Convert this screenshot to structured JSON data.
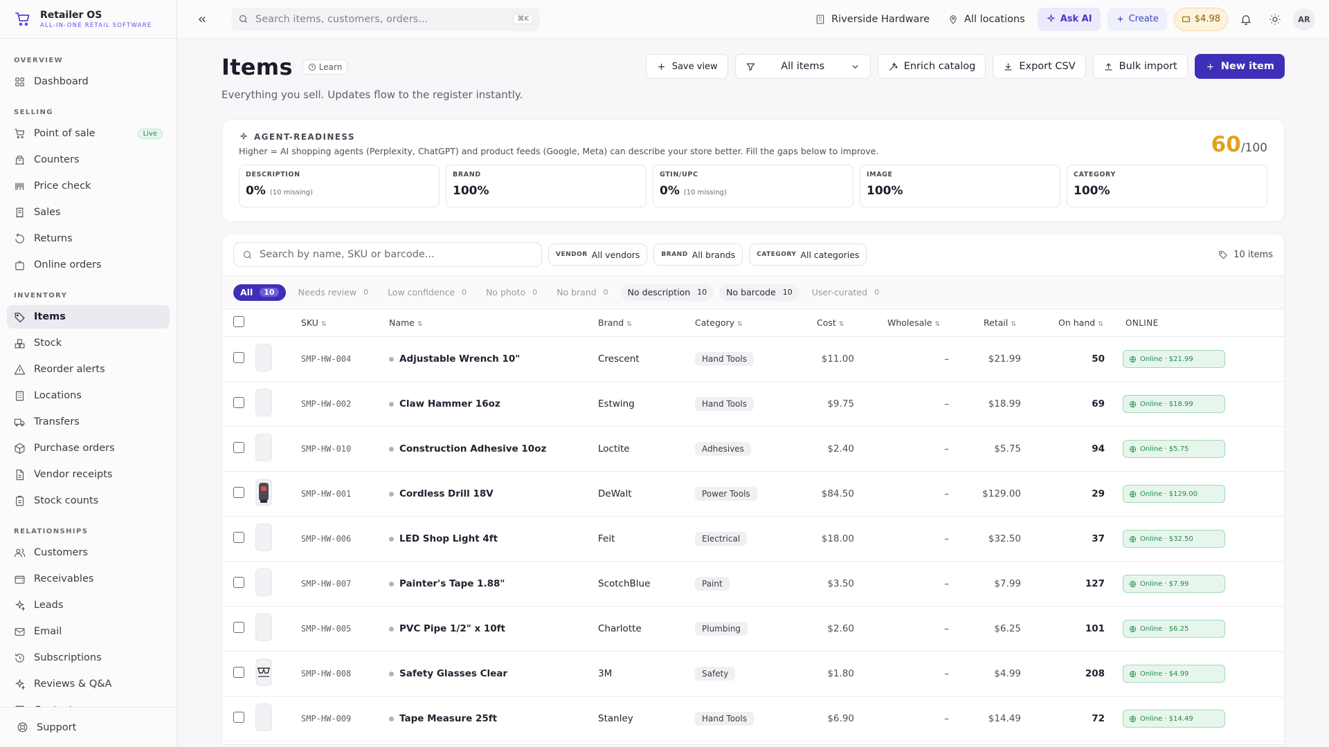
{
  "app": {
    "name": "Retailer OS",
    "tagline": "ALL-IN-ONE RETAIL SOFTWARE"
  },
  "sidebar": {
    "sections": [
      {
        "title": "OVERVIEW",
        "items": [
          {
            "label": "Dashboard",
            "icon": "grid-icon"
          }
        ]
      },
      {
        "title": "SELLING",
        "items": [
          {
            "label": "Point of sale",
            "icon": "cart-icon",
            "badge": "Live"
          },
          {
            "label": "Counters",
            "icon": "counter-icon"
          },
          {
            "label": "Price check",
            "icon": "barcode-icon"
          },
          {
            "label": "Sales",
            "icon": "receipt-icon"
          },
          {
            "label": "Returns",
            "icon": "return-icon"
          },
          {
            "label": "Online orders",
            "icon": "bag-icon"
          }
        ]
      },
      {
        "title": "INVENTORY",
        "items": [
          {
            "label": "Items",
            "icon": "tag-icon",
            "active": true
          },
          {
            "label": "Stock",
            "icon": "boxes-icon"
          },
          {
            "label": "Reorder alerts",
            "icon": "warning-icon"
          },
          {
            "label": "Locations",
            "icon": "building-icon"
          },
          {
            "label": "Transfers",
            "icon": "truck-icon"
          },
          {
            "label": "Purchase orders",
            "icon": "package-icon"
          },
          {
            "label": "Vendor receipts",
            "icon": "file-icon"
          },
          {
            "label": "Stock counts",
            "icon": "clipboard-icon"
          }
        ]
      },
      {
        "title": "RELATIONSHIPS",
        "items": [
          {
            "label": "Customers",
            "icon": "users-icon"
          },
          {
            "label": "Receivables",
            "icon": "wallet-icon"
          },
          {
            "label": "Leads",
            "icon": "sparkle-icon"
          },
          {
            "label": "Email",
            "icon": "mail-icon"
          },
          {
            "label": "Subscriptions",
            "icon": "repeat-icon"
          },
          {
            "label": "Reviews & Q&A",
            "icon": "sparkle-icon"
          },
          {
            "label": "Contacts",
            "icon": "contact-icon"
          }
        ]
      }
    ],
    "support_label": "Support"
  },
  "topbar": {
    "search_placeholder": "Search items, customers, orders...",
    "search_shortcut": "⌘K",
    "store": "Riverside Hardware",
    "locations": "All locations",
    "ask_ai": "Ask AI",
    "create": "Create",
    "credit": "$4.98",
    "avatar": "AR"
  },
  "page": {
    "title": "Items",
    "learn": "Learn",
    "subtitle": "Everything you sell. Updates flow to the register instantly.",
    "actions": {
      "save_view": "Save view",
      "filter_view": "All items",
      "enrich": "Enrich catalog",
      "export": "Export CSV",
      "import": "Bulk import",
      "new_item": "New item"
    }
  },
  "readiness": {
    "label": "AGENT-READINESS",
    "description": "Higher = AI shopping agents (Perplexity, ChatGPT) and product feeds (Google, Meta) can describe your store better. Fill the gaps below to improve.",
    "score": "60",
    "score_max": "/100",
    "metrics": [
      {
        "label": "DESCRIPTION",
        "value": "0%",
        "note": "(10 missing)"
      },
      {
        "label": "BRAND",
        "value": "100%",
        "note": ""
      },
      {
        "label": "GTIN/UPC",
        "value": "0%",
        "note": "(10 missing)"
      },
      {
        "label": "IMAGE",
        "value": "100%",
        "note": ""
      },
      {
        "label": "CATEGORY",
        "value": "100%",
        "note": ""
      }
    ]
  },
  "filters": {
    "search_placeholder": "Search by name, SKU or barcode...",
    "vendor": {
      "key": "VENDOR",
      "value": "All vendors"
    },
    "brand": {
      "key": "BRAND",
      "value": "All brands"
    },
    "category": {
      "key": "CATEGORY",
      "value": "All categories"
    },
    "count": "10 items"
  },
  "tabs": [
    {
      "label": "All",
      "count": "10",
      "active": true
    },
    {
      "label": "Needs review",
      "count": "0"
    },
    {
      "label": "Low confidence",
      "count": "0"
    },
    {
      "label": "No photo",
      "count": "0"
    },
    {
      "label": "No brand",
      "count": "0"
    },
    {
      "label": "No description",
      "count": "10",
      "hasval": true
    },
    {
      "label": "No barcode",
      "count": "10",
      "hasval": true
    },
    {
      "label": "User-curated",
      "count": "0"
    }
  ],
  "table": {
    "columns": {
      "sku": "SKU",
      "name": "Name",
      "brand": "Brand",
      "category": "Category",
      "cost": "Cost",
      "wholesale": "Wholesale",
      "retail": "Retail",
      "on_hand": "On hand",
      "online": "ONLINE"
    },
    "rows": [
      {
        "sku": "SMP-HW-004",
        "name": "Adjustable Wrench 10\"",
        "brand": "Crescent",
        "category": "Hand Tools",
        "cost": "$11.00",
        "wholesale": "–",
        "retail": "$21.99",
        "on_hand": "50",
        "online": "Online · $21.99",
        "thumb": "blank"
      },
      {
        "sku": "SMP-HW-002",
        "name": "Claw Hammer 16oz",
        "brand": "Estwing",
        "category": "Hand Tools",
        "cost": "$9.75",
        "wholesale": "–",
        "retail": "$18.99",
        "on_hand": "69",
        "online": "Online · $18.99",
        "thumb": "blank"
      },
      {
        "sku": "SMP-HW-010",
        "name": "Construction Adhesive 10oz",
        "brand": "Loctite",
        "category": "Adhesives",
        "cost": "$2.40",
        "wholesale": "–",
        "retail": "$5.75",
        "on_hand": "94",
        "online": "Online · $5.75",
        "thumb": "blank"
      },
      {
        "sku": "SMP-HW-001",
        "name": "Cordless Drill 18V",
        "brand": "DeWalt",
        "category": "Power Tools",
        "cost": "$84.50",
        "wholesale": "–",
        "retail": "$129.00",
        "on_hand": "29",
        "online": "Online · $129.00",
        "thumb": "drill"
      },
      {
        "sku": "SMP-HW-006",
        "name": "LED Shop Light 4ft",
        "brand": "Feit",
        "category": "Electrical",
        "cost": "$18.00",
        "wholesale": "–",
        "retail": "$32.50",
        "on_hand": "37",
        "online": "Online · $32.50",
        "thumb": "blank"
      },
      {
        "sku": "SMP-HW-007",
        "name": "Painter's Tape 1.88\"",
        "brand": "ScotchBlue",
        "category": "Paint",
        "cost": "$3.50",
        "wholesale": "–",
        "retail": "$7.99",
        "on_hand": "127",
        "online": "Online · $7.99",
        "thumb": "blank"
      },
      {
        "sku": "SMP-HW-005",
        "name": "PVC Pipe 1/2\" x 10ft",
        "brand": "Charlotte",
        "category": "Plumbing",
        "cost": "$2.60",
        "wholesale": "–",
        "retail": "$6.25",
        "on_hand": "101",
        "online": "Online · $6.25",
        "thumb": "blank"
      },
      {
        "sku": "SMP-HW-008",
        "name": "Safety Glasses Clear",
        "brand": "3M",
        "category": "Safety",
        "cost": "$1.80",
        "wholesale": "–",
        "retail": "$4.99",
        "on_hand": "208",
        "online": "Online · $4.99",
        "thumb": "glasses"
      },
      {
        "sku": "SMP-HW-009",
        "name": "Tape Measure 25ft",
        "brand": "Stanley",
        "category": "Hand Tools",
        "cost": "$6.90",
        "wholesale": "–",
        "retail": "$14.49",
        "on_hand": "72",
        "online": "Online · $14.49",
        "thumb": "blank"
      }
    ]
  },
  "colors": {
    "accent": "#3e2fb8",
    "score": "#e3a11c",
    "online": "#1f8a4c"
  }
}
